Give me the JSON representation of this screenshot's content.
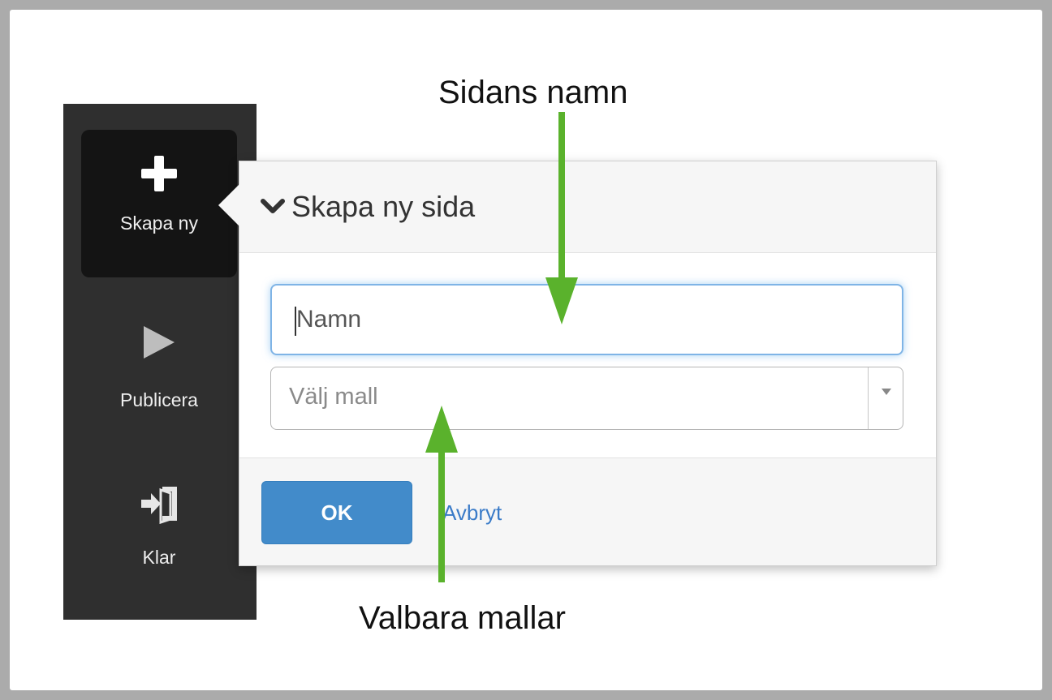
{
  "sidebar": {
    "items": [
      {
        "label": "Skapa ny",
        "icon": "plus-icon",
        "active": true
      },
      {
        "label": "Publicera",
        "icon": "play-icon",
        "active": false
      },
      {
        "label": "Klar",
        "icon": "sign-in-icon",
        "active": false
      }
    ]
  },
  "dialog": {
    "title": "Skapa ny sida",
    "title_icon": "chevron-down-icon",
    "name_placeholder": "Namn",
    "template_placeholder": "Välj mall",
    "ok_label": "OK",
    "cancel_label": "Avbryt"
  },
  "annotations": {
    "page_name": "Sidans namn",
    "templates": "Valbara mallar",
    "arrow_color": "#5ab22c"
  },
  "colors": {
    "sidebar_bg": "#2f2f2f",
    "primary_button": "#428bca",
    "link": "#3a7bc8"
  }
}
